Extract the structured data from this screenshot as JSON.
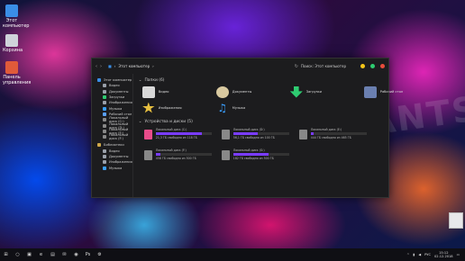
{
  "desktop": {
    "icons": [
      {
        "label": "Этот компьютер",
        "color": "#3a8ee6"
      },
      {
        "label": "Корзина",
        "color": "#cfd3da"
      },
      {
        "label": "Панель управления",
        "color": "#e05a3a"
      }
    ],
    "watermark": "DEVIANTSU"
  },
  "window": {
    "breadcrumb": "Этот компьютер",
    "search_placeholder": "Поиск: Этот компьютер",
    "dots": [
      "#f5c518",
      "#2ecc71",
      "#e74c3c"
    ],
    "sidebar": [
      {
        "label": "Этот компьютер",
        "color": "#3a8ee6"
      },
      {
        "label": "Видео",
        "color": "#9aa0aa"
      },
      {
        "label": "Документы",
        "color": "#9aa0aa"
      },
      {
        "label": "Загрузки",
        "color": "#2ecc71"
      },
      {
        "label": "Изображения",
        "color": "#9aa0aa"
      },
      {
        "label": "Музыка",
        "color": "#3aa0ff"
      },
      {
        "label": "Рабочий стол",
        "color": "#5aa0ff"
      },
      {
        "label": "Локальный диск (C:)",
        "color": "#888"
      },
      {
        "label": "Локальный диск (D:)",
        "color": "#888"
      },
      {
        "label": "Локальный диск (E:)",
        "color": "#888"
      },
      {
        "label": "Локальный диск (F:)",
        "color": "#888"
      },
      {
        "label": "Библиотеки",
        "color": "#cfa84a"
      },
      {
        "label": "Видео",
        "color": "#9aa0aa"
      },
      {
        "label": "Документы",
        "color": "#9aa0aa"
      },
      {
        "label": "Изображения",
        "color": "#9aa0aa"
      },
      {
        "label": "Музыка",
        "color": "#3aa0ff"
      }
    ],
    "folders_title": "Папки (6)",
    "folders": [
      {
        "label": "Видео",
        "color": "#d8d8d8"
      },
      {
        "label": "Документы",
        "color": "#d9c9a0"
      },
      {
        "label": "Загрузки",
        "color": "#2ecc71"
      },
      {
        "label": "Рабочий стол",
        "color": "#6a7fb0"
      },
      {
        "label": "Изображения",
        "color": "#e8c040"
      },
      {
        "label": "Музыка",
        "color": "#3aa0ff"
      }
    ],
    "drives_title": "Устройства и диски (5)",
    "drives": [
      {
        "label": "Локальный диск (C:)",
        "free": "21,3 ГБ свободно из 118 ГБ",
        "used": 0.82,
        "color": "#e84c8a"
      },
      {
        "label": "Локальный диск (D:)",
        "free": "56,1 ГБ свободно из 100 ГБ",
        "used": 0.44,
        "color": "#888"
      },
      {
        "label": "Локальный диск (E:)",
        "free": "444 ГБ свободно из 465 ГБ",
        "used": 0.05,
        "color": "#888"
      },
      {
        "label": "Локальный диск (F:)",
        "free": "458 ГБ свободно из 500 ГБ",
        "used": 0.08,
        "color": "#888"
      },
      {
        "label": "Локальный диск (G:)",
        "free": "182 ГБ свободно из 500 ГБ",
        "used": 0.64,
        "color": "#888"
      }
    ]
  },
  "taskbar": {
    "apps": [
      "⊞",
      "○",
      "▣",
      "e",
      "▤",
      "✉",
      "◉",
      "Ps",
      "⚙"
    ],
    "lang": "РУС",
    "time": "15:12",
    "date": "02.12.2018"
  }
}
